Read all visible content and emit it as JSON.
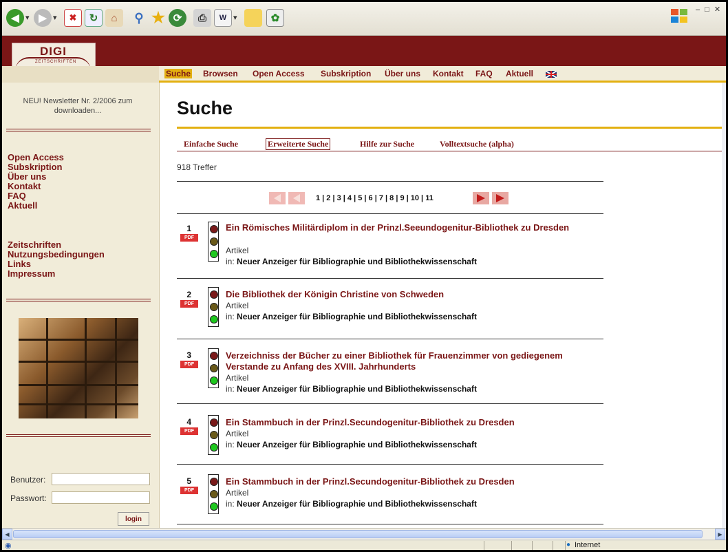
{
  "toolbar": {
    "icons": [
      "back-icon",
      "forward-icon",
      "stop-icon",
      "refresh-icon",
      "home-icon",
      "search-icon",
      "favorites-icon",
      "history-icon",
      "print-icon",
      "edit-icon",
      "folder-icon",
      "messenger-icon"
    ]
  },
  "header": {
    "logo_text": "DIGI",
    "logo_subtext": "ZEITSCHRIFTEN"
  },
  "nav": {
    "items": [
      "Suche",
      "Browsen",
      "Open Access",
      "Subskription",
      "Über uns",
      "Kontakt",
      "FAQ",
      "Aktuell"
    ],
    "active": "Suche"
  },
  "sidebar": {
    "news": "NEU! Newsletter Nr. 2/2006 zum downloaden...",
    "links_primary": [
      "Open Access",
      "Subskription",
      "Über uns",
      "Kontakt",
      "FAQ",
      "Aktuell"
    ],
    "links_secondary": [
      "Zeitschriften",
      "Nutzungsbedingungen",
      "Links",
      "Impressum"
    ],
    "login": {
      "user_label": "Benutzer:",
      "password_label": "Passwort:",
      "user_value": "",
      "password_value": "",
      "button_label": "login"
    }
  },
  "main": {
    "title": "Suche",
    "tabs": [
      "Einfache Suche",
      "Erweiterte Suche",
      "Hilfe zur Suche",
      "Volltextsuche (alpha)"
    ],
    "active_tab": "Erweiterte Suche",
    "hits": "918 Treffer",
    "pagination": "1 | 2 | 3 | 4 | 5 | 6 | 7 | 8 | 9 | 10 | 11",
    "results": [
      {
        "num": "1",
        "title": "Ein Römisches Militärdiplom in der Prinzl.Seeundogenitur-Bibliothek zu Dresden",
        "type": "Artikel",
        "src_prefix": "in:",
        "source": "Neuer Anzeiger für Bibliographie und Bibliothekwissenschaft"
      },
      {
        "num": "2",
        "title": "Die Bibliothek der Königin Christine von Schweden",
        "type": "Artikel",
        "src_prefix": "in:",
        "source": "Neuer Anzeiger für Bibliographie und Bibliothekwissenschaft"
      },
      {
        "num": "3",
        "title": "Verzeichniss der Bücher zu einer Bibliothek für Frauenzimmer von gediegenem Verstande zu Anfang des XVIII. Jahrhunderts",
        "type": "Artikel",
        "src_prefix": "in:",
        "source": "Neuer Anzeiger für Bibliographie und Bibliothekwissenschaft"
      },
      {
        "num": "4",
        "title": "Ein Stammbuch in der Prinzl.Secundogenitur-Bibliothek zu Dresden",
        "type": "Artikel",
        "src_prefix": "in:",
        "source": "Neuer Anzeiger für Bibliographie und Bibliothekwissenschaft"
      },
      {
        "num": "5",
        "title": "Ein Stammbuch in der Prinzl.Secundogenitur-Bibliothek zu Dresden",
        "type": "Artikel",
        "src_prefix": "in:",
        "source": "Neuer Anzeiger für Bibliographie und Bibliothekwissenschaft"
      }
    ],
    "pdf_label": "PDF"
  },
  "statusbar": {
    "zone": "Internet"
  },
  "colors": {
    "brand": "#7a1616",
    "accent": "#e3b011",
    "sidebar_bg": "#f1ecd9"
  }
}
